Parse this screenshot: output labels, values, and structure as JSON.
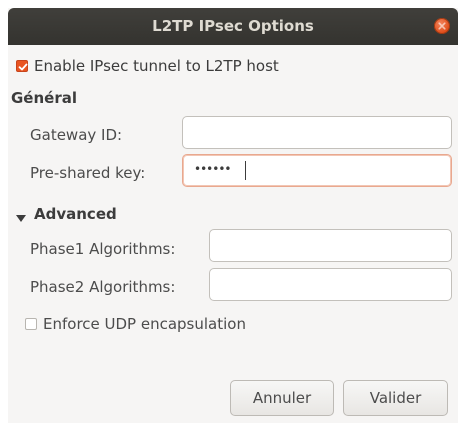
{
  "window": {
    "title": "L2TP IPsec Options"
  },
  "enable_ipsec": {
    "label": "Enable IPsec tunnel to L2TP host",
    "checked": true
  },
  "general": {
    "heading": "Général",
    "gateway_id_label": "Gateway ID:",
    "gateway_id_value": "",
    "psk_label": "Pre-shared key:",
    "psk_value": "••••••"
  },
  "advanced": {
    "heading": "Advanced",
    "expanded": true,
    "phase1_label": "Phase1 Algorithms:",
    "phase1_value": "",
    "phase2_label": "Phase2 Algorithms:",
    "phase2_value": ""
  },
  "enforce_udp": {
    "label": "Enforce UDP encapsulation",
    "checked": false
  },
  "buttons": {
    "cancel": "Annuler",
    "ok": "Valider"
  },
  "colors": {
    "accent": "#e95420",
    "titlebar": "#3a3935",
    "background": "#f6f5f4"
  }
}
